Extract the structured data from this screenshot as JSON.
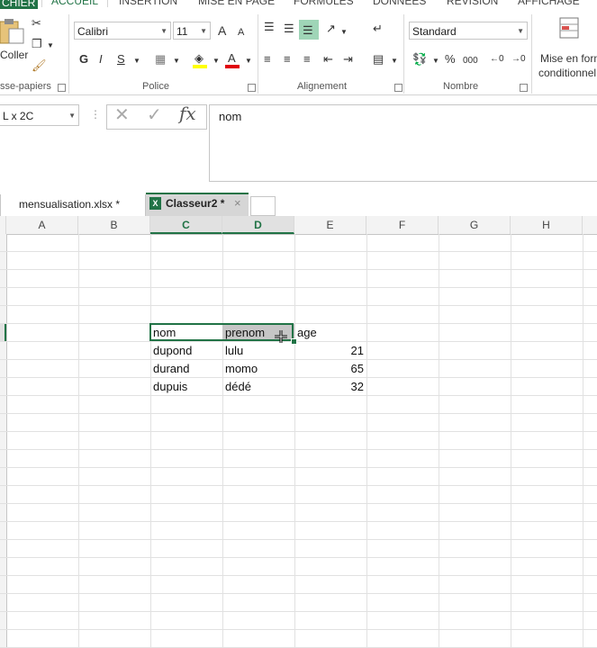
{
  "ribbon_tabs": {
    "file": "CHIER",
    "home": "ACCUEIL",
    "insert": "INSERTION",
    "layout": "MISE EN PAGE",
    "formulas": "FORMULES",
    "data": "DONNÉES",
    "review": "RÉVISION",
    "view": "AFFICHAGE"
  },
  "clipboard": {
    "paste_label": "Coller",
    "group_label": "sse-papiers"
  },
  "font": {
    "name": "Calibri",
    "size": "11",
    "bold": "G",
    "italic": "I",
    "underline": "S",
    "grow": "A",
    "shrink": "A",
    "font_color_letter": "A",
    "group_label": "Police"
  },
  "alignment": {
    "group_label": "Alignement"
  },
  "number": {
    "format": "Standard",
    "percent": "%",
    "thousands": "000",
    "group_label": "Nombre"
  },
  "styles": {
    "cond_format_line1": "Mise en form",
    "cond_format_line2": "conditionnel"
  },
  "formula_bar": {
    "name_box": "L x 2C",
    "fx": "fx",
    "content": "nom"
  },
  "workbook_tabs": [
    {
      "label": "mensualisation.xlsx *"
    },
    {
      "label": "Classeur2 *",
      "close": "×"
    }
  ],
  "columns": [
    "A",
    "B",
    "C",
    "D",
    "E",
    "F",
    "G",
    "H"
  ],
  "cells": {
    "c_header": "nom",
    "d_header": "prenom",
    "e_header": "age",
    "rows": [
      {
        "nom": "dupond",
        "prenom": "lulu",
        "age": "21"
      },
      {
        "nom": "durand",
        "prenom": "momo",
        "age": "65"
      },
      {
        "nom": "dupuis",
        "prenom": "dédé",
        "age": "32"
      }
    ]
  },
  "colors": {
    "accent": "#217346",
    "selection_fill": "#c6c6c6"
  }
}
